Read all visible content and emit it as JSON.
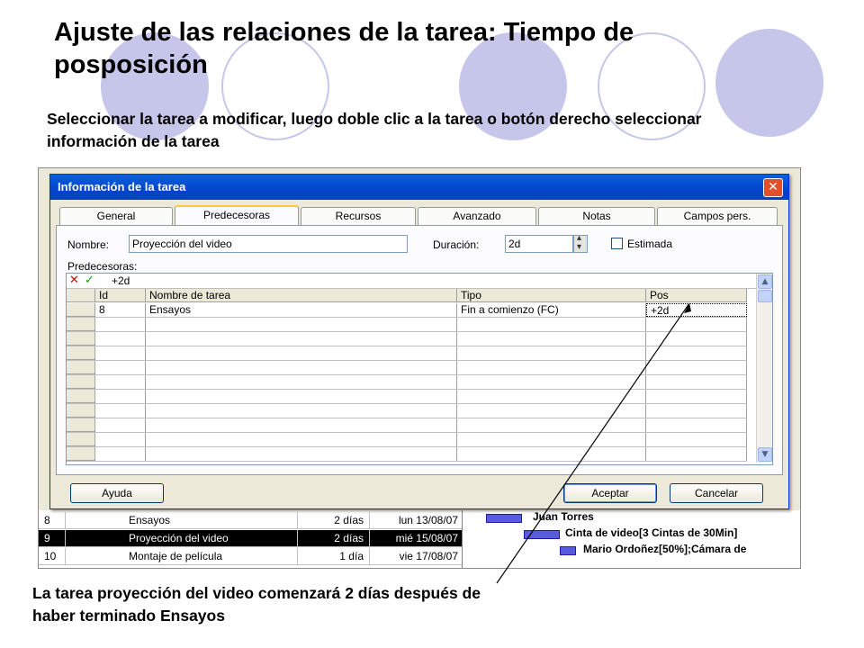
{
  "slide": {
    "title": "Ajuste de las relaciones de la tarea: Tiempo de posposición",
    "subtitle": "Seleccionar la tarea a modificar, luego doble clic a la tarea o botón derecho seleccionar información de la tarea",
    "caption": "La tarea proyección del video comenzará 2 días después de haber terminado Ensayos"
  },
  "dialog": {
    "title": "Información de la tarea",
    "close_glyph": "✕",
    "tabs": [
      {
        "label": "General"
      },
      {
        "label": "Predecesoras"
      },
      {
        "label": "Recursos"
      },
      {
        "label": "Avanzado"
      },
      {
        "label": "Notas"
      },
      {
        "label": "Campos pers."
      }
    ],
    "active_tab": "Predecesoras",
    "nombre_label": "Nombre:",
    "nombre_value": "Proyección del video",
    "duracion_label": "Duración:",
    "duracion_value": "2d",
    "estimada_label": "Estimada",
    "estimada_checked": false,
    "predecesoras_label": "Predecesoras:",
    "edit_value": "+2d",
    "columns": [
      "Id",
      "Nombre de tarea",
      "Tipo",
      "Pos"
    ],
    "rows": [
      {
        "id": "8",
        "name": "Ensayos",
        "tipo": "Fin a comienzo (FC)",
        "pos": "+2d"
      }
    ],
    "buttons": {
      "help": "Ayuda",
      "accept": "Aceptar",
      "cancel": "Cancelar"
    }
  },
  "background_tasks": [
    {
      "id": "8",
      "name": "Ensayos",
      "duration": "2 días",
      "start": "lun 13/08/07",
      "selected": false
    },
    {
      "id": "9",
      "name": "Proyección del video",
      "duration": "2 días",
      "start": "mié 15/08/07",
      "selected": true
    },
    {
      "id": "10",
      "name": "Montaje de película",
      "duration": "1 día",
      "start": "vie 17/08/07",
      "selected": false
    }
  ],
  "gantt_labels": [
    "Juan Torres",
    "Cinta de video[3 Cintas de 30Min]",
    "Mario Ordoñez[50%];Cámara de"
  ],
  "colors": {
    "accent_circle": "#c6c6ea",
    "titlebar": "#0245c9",
    "gantt_bar": "#5a5ae0"
  },
  "icons": [
    "close-icon",
    "cancel-x-icon",
    "confirm-check-icon",
    "scroll-up-icon",
    "scroll-down-icon",
    "spin-icon"
  ]
}
